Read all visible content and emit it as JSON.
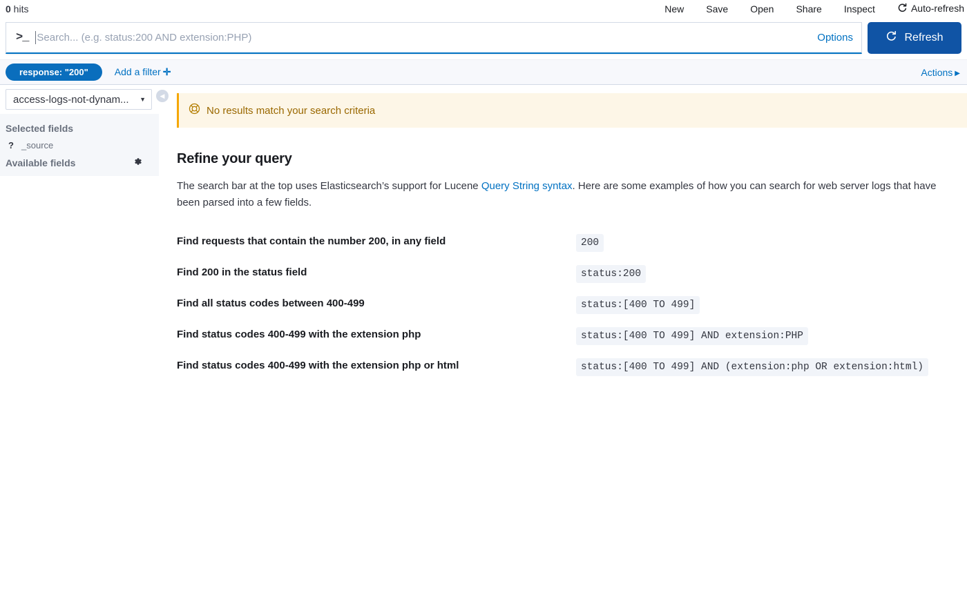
{
  "topbar": {
    "hits_count": "0",
    "hits_label": " hits",
    "nav": [
      {
        "label": "New",
        "icon": null
      },
      {
        "label": "Save",
        "icon": null
      },
      {
        "label": "Open",
        "icon": null
      },
      {
        "label": "Share",
        "icon": null
      },
      {
        "label": "Inspect",
        "icon": null
      },
      {
        "label": "Auto-refresh",
        "icon": "refresh-icon"
      }
    ]
  },
  "query": {
    "prompt_icon": ">_",
    "value": "",
    "placeholder": "Search... (e.g. status:200 AND extension:PHP)",
    "options_label": "Options",
    "refresh_label": "Refresh",
    "refresh_icon": "refresh-icon",
    "accent_color": "#1054a5"
  },
  "filters": {
    "pills": [
      {
        "label": "response: \"200\"",
        "color": "#0a6ebd"
      }
    ],
    "add_filter_label": "Add a filter",
    "add_filter_icon": "plus-icon",
    "actions_label": "Actions",
    "actions_icon": "triangle-right-icon"
  },
  "sidebar": {
    "index_pattern": "access-logs-not-dynam...",
    "index_pattern_icon": "chevron-down-icon",
    "collapse_icon": "chevron-left-icon",
    "selected_fields_title": "Selected fields",
    "selected_fields": [
      {
        "type_icon": "?",
        "name": "_source"
      }
    ],
    "available_fields_title": "Available fields",
    "available_fields_settings_icon": "gear-icon"
  },
  "callout": {
    "icon": "lifebuoy-icon",
    "text": "No results match your search criteria",
    "accent_color": "#f5a700",
    "background_color": "#fdf6e7",
    "text_color": "#9a6800"
  },
  "refine": {
    "title": "Refine your query",
    "paragraph_before_link": "The search bar at the top uses Elasticsearch’s support for Lucene ",
    "link_text": "Query String syntax",
    "paragraph_after_link": ". Here are some examples of how you can search for web server logs that have been parsed into a few fields.",
    "link_color": "#0071c2",
    "examples": [
      {
        "description": "Find requests that contain the number 200, in any field",
        "code": "200"
      },
      {
        "description": "Find 200 in the status field",
        "code": "status:200"
      },
      {
        "description": "Find all status codes between 400-499",
        "code": "status:[400 TO 499]"
      },
      {
        "description": "Find status codes 400-499 with the extension php",
        "code": "status:[400 TO 499] AND extension:PHP"
      },
      {
        "description": "Find status codes 400-499 with the extension php or html",
        "code": "status:[400 TO 499] AND (extension:php OR extension:html)"
      }
    ]
  }
}
